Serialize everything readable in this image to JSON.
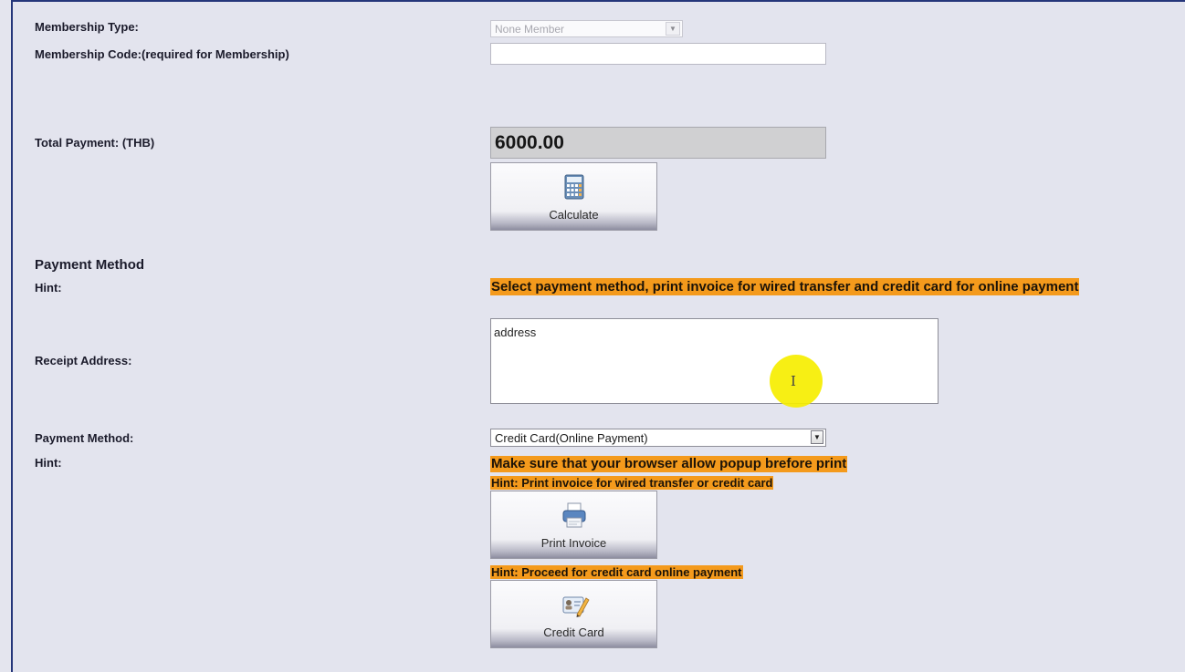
{
  "membership": {
    "type_label": "Membership Type:",
    "type_value": "None Member",
    "code_label": "Membership Code:(required for Membership)",
    "code_value": ""
  },
  "total": {
    "label": "Total Payment: (THB)",
    "value": "6000.00",
    "calculate_label": "Calculate"
  },
  "payment_section": {
    "heading": "Payment Method",
    "hint_label": "Hint:",
    "hint_text": "Select payment method, print invoice for wired transfer and credit card for online payment"
  },
  "receipt": {
    "label": "Receipt Address:",
    "value": "address"
  },
  "payment_method": {
    "label": "Payment Method:",
    "selected": "Credit Card(Online Payment)",
    "hint_label": "Hint:",
    "hint_popup": "Make sure that your browser allow popup brefore print",
    "hint_print": "Hint: Print invoice for wired transfer or credit card",
    "print_label": "Print Invoice",
    "hint_proceed": "Hint: Proceed for credit card online payment",
    "credit_label": "Credit Card"
  },
  "icons": {
    "calculator": "calculator-icon",
    "printer": "printer-icon",
    "credit_card": "credit-card-icon",
    "dropdown": "chevron-down-icon",
    "text_cursor": "text-cursor-icon"
  },
  "colors": {
    "background": "#e3e4ee",
    "hint": "#f49a1c",
    "frame_border": "#25367a",
    "total_box": "#d0d0d2",
    "cursor_highlight": "#f6ee00"
  }
}
